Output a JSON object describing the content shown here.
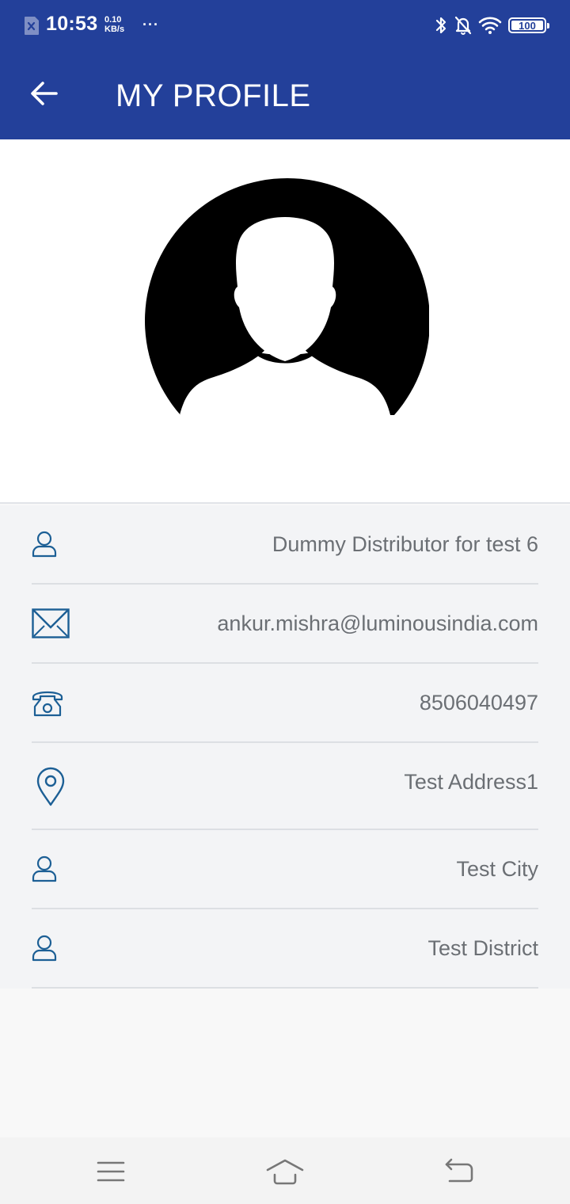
{
  "status_bar": {
    "time": "10:53",
    "net_speed_value": "0.10",
    "net_speed_unit": "KB/s",
    "more": "···",
    "battery": "100"
  },
  "app_bar": {
    "title": "MY PROFILE",
    "back_icon": "arrow-left-icon"
  },
  "avatar": {
    "icon": "default-user-avatar"
  },
  "profile": {
    "name": "Dummy Distributor for test 6",
    "email": "ankur.mishra@luminousindia.com",
    "phone": "8506040497",
    "address": "Test Address1",
    "city": "Test City",
    "district": "Test District"
  },
  "nav_bar": {
    "menu_icon": "menu-icon",
    "home_icon": "home-icon",
    "back_icon": "back-icon"
  },
  "colors": {
    "header": "#23409a",
    "icon_accent": "#1c5f95",
    "value_text": "#6b6f74"
  }
}
